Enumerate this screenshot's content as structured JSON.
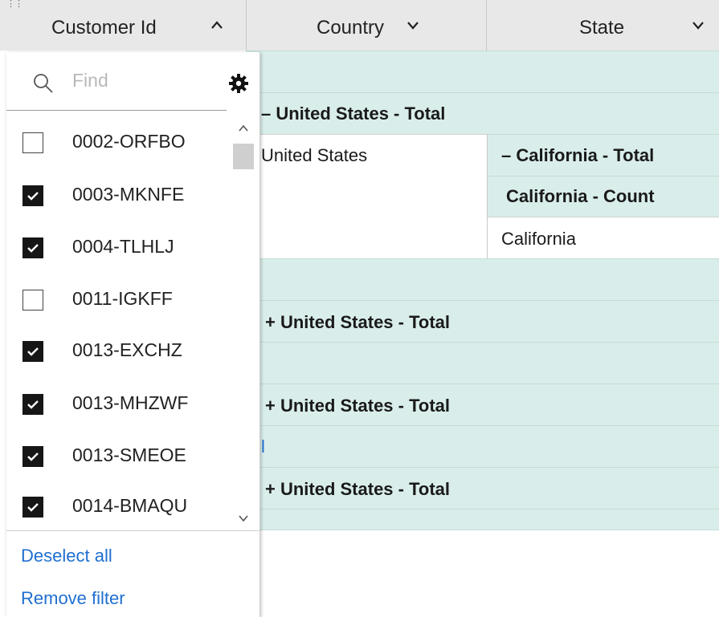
{
  "header": {
    "col1": "Customer Id",
    "col2": "Country",
    "col3": "State"
  },
  "grid": {
    "group1_total": "– United States - Total",
    "country_value": "United States",
    "state_total": "– California - Total",
    "state_count": "California - Count",
    "state_value": "California",
    "group2_total": "+ United States - Total",
    "group3_total": "+ United States - Total",
    "partial_char": "l",
    "group4_total": "+ United States - Total"
  },
  "filter": {
    "search_placeholder": "Find",
    "items": [
      {
        "label": "0002-ORFBO",
        "checked": false
      },
      {
        "label": "0003-MKNFE",
        "checked": true
      },
      {
        "label": "0004-TLHLJ",
        "checked": true
      },
      {
        "label": "0011-IGKFF",
        "checked": false
      },
      {
        "label": "0013-EXCHZ",
        "checked": true
      },
      {
        "label": "0013-MHZWF",
        "checked": true
      },
      {
        "label": "0013-SMEOE",
        "checked": true
      },
      {
        "label": "0014-BMAQU",
        "checked": true
      }
    ],
    "deselect_all": "Deselect all",
    "remove_filter": "Remove filter"
  },
  "colors": {
    "band": "#d9eeea",
    "header": "#e8e8e8",
    "link": "#1f6fd0",
    "checkbox": "#161616"
  }
}
